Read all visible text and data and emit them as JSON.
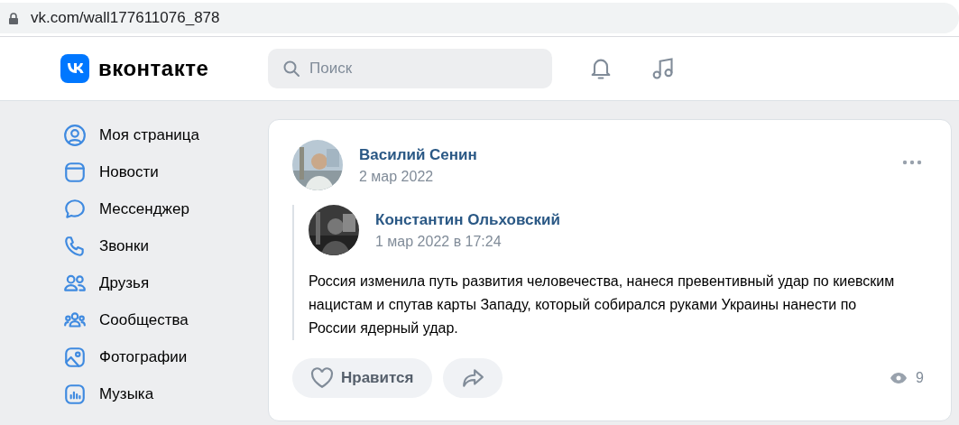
{
  "browser": {
    "url": "vk.com/wall177611076_878"
  },
  "header": {
    "logo": "вконтакте",
    "search": {
      "placeholder": "Поиск"
    }
  },
  "sidebar": {
    "items": [
      {
        "kind": "user",
        "label": "Моя страница",
        "selected": false
      },
      {
        "kind": "news",
        "label": "Новости",
        "selected": false
      },
      {
        "kind": "chat",
        "label": "Мессенджер",
        "selected": false
      },
      {
        "kind": "phone",
        "label": "Звонки",
        "selected": false
      },
      {
        "kind": "friends",
        "label": "Друзья",
        "selected": false
      },
      {
        "kind": "groups",
        "label": "Сообщества",
        "selected": false
      },
      {
        "label": "Фотографии",
        "selected": false
      },
      {
        "kind": "music",
        "label": "Музыка",
        "selected": false
      }
    ]
  },
  "post": {
    "author": "Василий Сенин",
    "date": "2 мар 2022",
    "repost": {
      "author": "Константин Ольховский",
      "date": "1 мар 2022 в 17:24",
      "text": "Россия изменила путь развития человечества, нанеся превентивный удар по киевским нацистам и спутав карты Западу, который собирался руками Украины нанести по России ядерный удар."
    },
    "like": {
      "label": "Нравится",
      "liked": false
    },
    "views": "9"
  }
}
